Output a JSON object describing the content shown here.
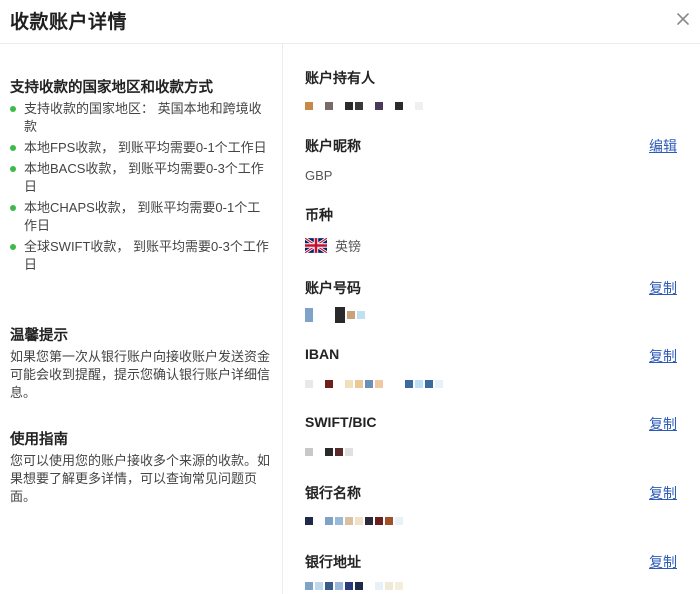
{
  "dialog": {
    "title": "收款账户详情",
    "close_icon": "close-icon"
  },
  "support": {
    "title": "支持收款的国家地区和收款方式",
    "items": [
      "支持收款的国家地区： 英国本地和跨境收款",
      "本地FPS收款， 到账平均需要0-1个工作日",
      "本地BACS收款， 到账平均需要0-3个工作日",
      "本地CHAPS收款， 到账平均需要0-1个工作日",
      "全球SWIFT收款， 到账平均需要0-3个工作日"
    ],
    "bullet_color": "#3dbb48"
  },
  "tips": {
    "title": "温馨提示",
    "text": "如果您第一次从银行账户向接收账户发送资金可能会收到提醒，提示您确认银行账户详细信息。"
  },
  "guide": {
    "title": "使用指南",
    "text": "您可以使用您的账户接收多个来源的收款。如果想要了解更多详情，可以查询常见问题页面。"
  },
  "fields": {
    "holder": {
      "label": "账户持有人"
    },
    "nickname": {
      "label": "账户昵称",
      "value": "GBP",
      "action": "编辑"
    },
    "currency": {
      "label": "币种",
      "value": "英镑",
      "flag_icon": "uk-flag-icon"
    },
    "account_number": {
      "label": "账户号码",
      "action": "复制"
    },
    "iban": {
      "label": "IBAN",
      "action": "复制"
    },
    "swift": {
      "label": "SWIFT/BIC",
      "action": "复制"
    },
    "bank_name": {
      "label": "银行名称",
      "action": "复制"
    },
    "bank_address": {
      "label": "银行地址",
      "action": "复制"
    }
  },
  "colors": {
    "link": "#2d5bb8",
    "divider": "#ececec"
  }
}
